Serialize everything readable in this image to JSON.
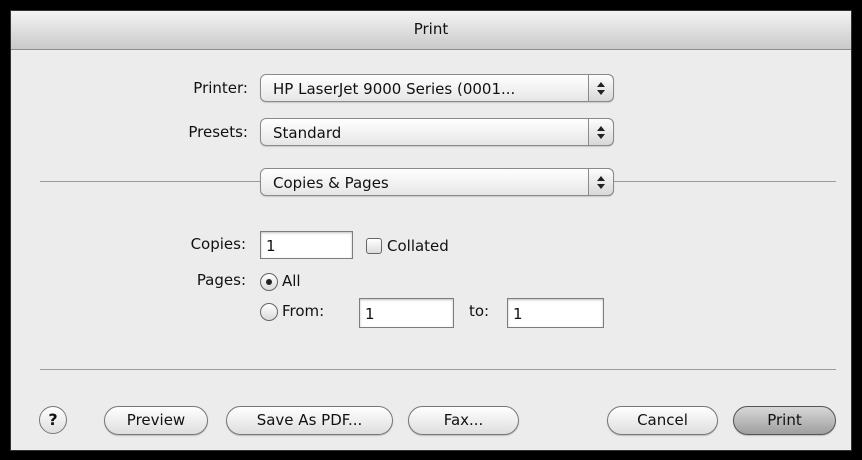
{
  "window": {
    "title": "Print"
  },
  "printer": {
    "label": "Printer:",
    "value": "HP LaserJet 9000 Series (0001..."
  },
  "presets": {
    "label": "Presets:",
    "value": "Standard"
  },
  "panel": {
    "value": "Copies & Pages"
  },
  "copies": {
    "label": "Copies:",
    "value": "1",
    "collated_label": "Collated",
    "collated_checked": false
  },
  "pages": {
    "label": "Pages:",
    "all_label": "All",
    "all_selected": true,
    "from_label": "From:",
    "from_value": "1",
    "to_label": "to:",
    "to_value": "1"
  },
  "buttons": {
    "help": "?",
    "preview": "Preview",
    "save_pdf": "Save As PDF...",
    "fax": "Fax...",
    "cancel": "Cancel",
    "print": "Print"
  }
}
